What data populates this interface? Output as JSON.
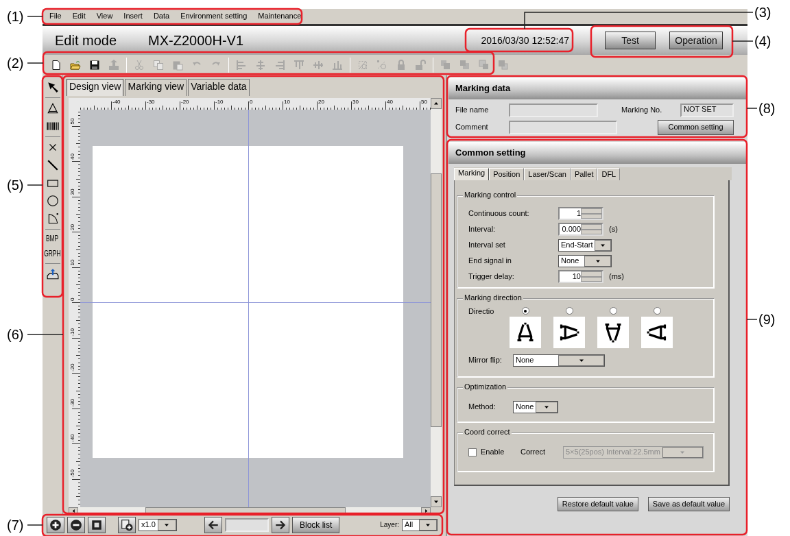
{
  "annotations_left": [
    "(1)",
    "(2)",
    "(5)",
    "(6)",
    "(7)"
  ],
  "annotations_right": [
    "(3)",
    "(4)",
    "(8)",
    "(9)"
  ],
  "menu": [
    "File",
    "Edit",
    "View",
    "Insert",
    "Data",
    "Environment setting",
    "Maintenance"
  ],
  "title_bar": {
    "mode": "Edit mode",
    "model": "MX-Z2000H-V1",
    "datetime": "2016/03/30 12:52:47",
    "buttons": [
      "Test",
      "Operation"
    ]
  },
  "toolbar_groups": [
    [
      {
        "disabled": false
      },
      {
        "disabled": false
      },
      {
        "disabled": false
      },
      {
        "disabled": true
      }
    ],
    [
      {
        "disabled": true
      },
      {
        "disabled": true
      },
      {
        "disabled": true
      },
      {
        "disabled": true
      },
      {
        "disabled": true
      }
    ],
    [
      {
        "disabled": true
      },
      {
        "disabled": true
      },
      {
        "disabled": true
      },
      {
        "disabled": true
      },
      {
        "disabled": true
      },
      {
        "disabled": true
      }
    ],
    [
      {
        "disabled": true
      },
      {
        "disabled": true
      },
      {
        "disabled": true
      },
      {
        "disabled": true
      }
    ],
    [
      {
        "disabled": true
      },
      {
        "disabled": true
      },
      {
        "disabled": true
      },
      {
        "disabled": true
      }
    ]
  ],
  "palette_labels": [
    "BMP",
    "GRPH"
  ],
  "canvas_tabs": [
    {
      "label": "Design view",
      "selected": true
    },
    {
      "label": "Marking view",
      "selected": false
    },
    {
      "label": "Variable data",
      "selected": false
    }
  ],
  "ruler": {
    "x_labels": [
      "-40",
      "-30",
      "-20",
      "-10",
      "0",
      "10",
      "20",
      "30",
      "40",
      "50"
    ],
    "y_labels": [
      "50",
      "40",
      "30",
      "20",
      "10",
      "0",
      "-10",
      "-20",
      "-30",
      "-40",
      "-50"
    ]
  },
  "bottom_bar": {
    "zoom": "x1.0",
    "block_list": "Block list",
    "layer_label": "Layer:",
    "layer": "All"
  },
  "marking_data": {
    "title": "Marking data",
    "file_name_label": "File name",
    "comment_label": "Comment",
    "marking_no_label": "Marking No.",
    "marking_no": "NOT SET",
    "button": "Common setting"
  },
  "common_setting": {
    "title": "Common setting",
    "tabs": [
      {
        "label": "Marking",
        "selected": true
      },
      {
        "label": "Position",
        "selected": false
      },
      {
        "label": "Laser/Scan",
        "selected": false
      },
      {
        "label": "Pallet",
        "selected": false
      },
      {
        "label": "DFL",
        "selected": false
      }
    ],
    "marking_control": {
      "legend": "Marking control",
      "rows": [
        {
          "kind": "spin",
          "label": "Continuous count:",
          "value": "1"
        },
        {
          "kind": "spin",
          "label": "Interval:",
          "value": "0.000",
          "unit": "(s)"
        },
        {
          "kind": "select",
          "label": "Interval set",
          "value": "End-Start"
        },
        {
          "kind": "select",
          "label": "End signal in",
          "value": "None"
        },
        {
          "kind": "spin",
          "label": "Trigger delay:",
          "value": "10",
          "unit": "(ms)"
        }
      ]
    },
    "marking_direction": {
      "legend": "Marking direction",
      "label": "Directio",
      "options": [
        {
          "selected": true
        },
        {
          "selected": false
        },
        {
          "selected": false
        },
        {
          "selected": false
        }
      ],
      "mirror_label": "Mirror flip:",
      "mirror": "None"
    },
    "optimization": {
      "legend": "Optimization",
      "method_label": "Method:",
      "method": "None"
    },
    "coord_correct": {
      "legend": "Coord correct",
      "enable_label": "Enable",
      "enable_checked": false,
      "correct_label": "Correct",
      "correct": "5×5(25pos) Interval:22.5mm",
      "correct_disabled": true
    },
    "buttons": [
      "Restore default value",
      "Save as default value"
    ]
  }
}
